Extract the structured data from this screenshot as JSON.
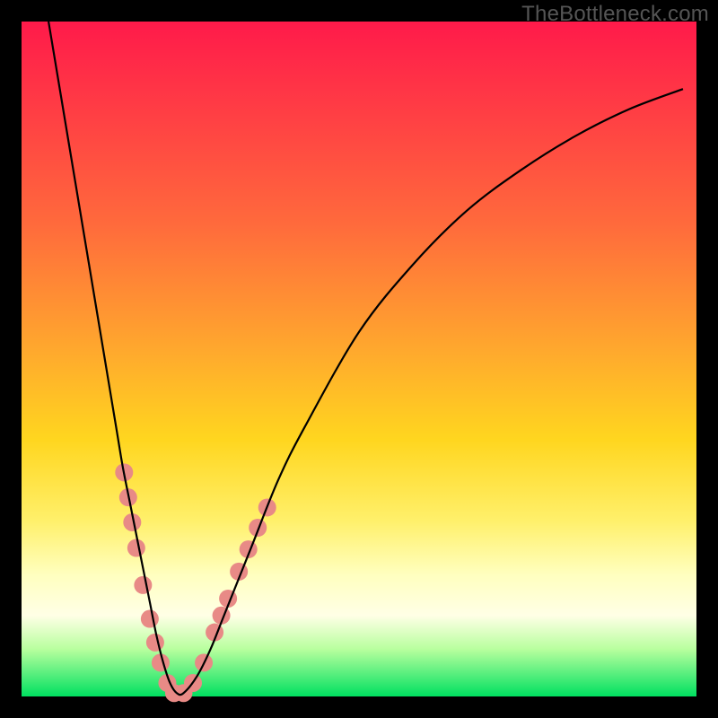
{
  "watermark": "TheBottleneck.com",
  "chart_data": {
    "type": "line",
    "title": "",
    "xlabel": "",
    "ylabel": "",
    "xlim": [
      0,
      100
    ],
    "ylim": [
      0,
      100
    ],
    "series": [
      {
        "name": "curve",
        "x": [
          4,
          6,
          8,
          10,
          12,
          14,
          15,
          16,
          17,
          18,
          19,
          20,
          21,
          22,
          23,
          24,
          26,
          28,
          30,
          34,
          38,
          42,
          50,
          58,
          66,
          74,
          82,
          90,
          98
        ],
        "y": [
          100,
          88,
          76,
          64,
          52,
          40,
          34,
          29,
          24,
          19,
          14,
          9,
          5,
          2,
          0.5,
          0.5,
          3,
          7,
          12,
          22,
          32,
          40,
          54,
          64,
          72,
          78,
          83,
          87,
          90
        ]
      }
    ],
    "highlight_points": [
      {
        "x": 15.2,
        "y": 33.2
      },
      {
        "x": 15.8,
        "y": 29.5
      },
      {
        "x": 16.4,
        "y": 25.8
      },
      {
        "x": 17.0,
        "y": 22.0
      },
      {
        "x": 18.0,
        "y": 16.5
      },
      {
        "x": 19.0,
        "y": 11.5
      },
      {
        "x": 19.8,
        "y": 8.0
      },
      {
        "x": 20.6,
        "y": 5.0
      },
      {
        "x": 21.6,
        "y": 2.0
      },
      {
        "x": 22.6,
        "y": 0.5
      },
      {
        "x": 24.0,
        "y": 0.5
      },
      {
        "x": 25.4,
        "y": 2.0
      },
      {
        "x": 27.0,
        "y": 5.0
      },
      {
        "x": 28.6,
        "y": 9.5
      },
      {
        "x": 29.6,
        "y": 12.0
      },
      {
        "x": 30.6,
        "y": 14.5
      },
      {
        "x": 32.2,
        "y": 18.5
      },
      {
        "x": 33.6,
        "y": 21.8
      },
      {
        "x": 35.0,
        "y": 25.0
      },
      {
        "x": 36.4,
        "y": 28.0
      }
    ],
    "highlight_radius": 10,
    "colors": {
      "curve": "#000000",
      "highlight": "#e88a86"
    }
  }
}
